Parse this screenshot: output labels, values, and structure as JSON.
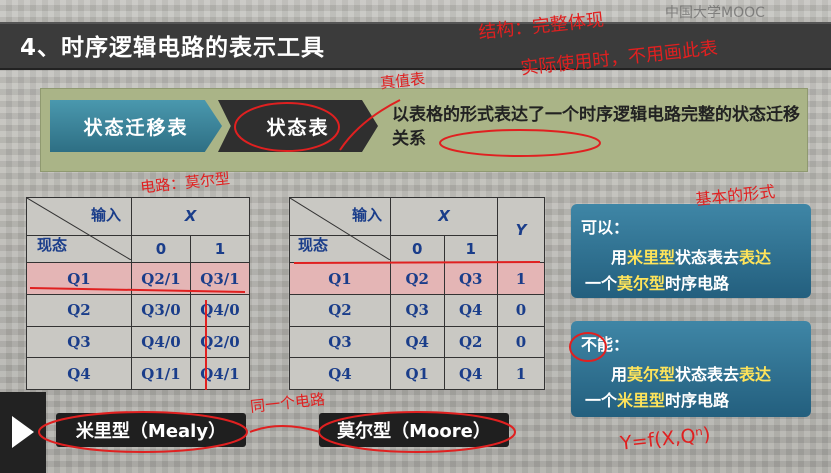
{
  "header": {
    "title": "4、时序逻辑电路的表示工具",
    "logo": "中国大学MOOC"
  },
  "tabs": {
    "tab1": "状态迁移表",
    "tab2": "状态表"
  },
  "description": "以表格的形式表达了一个时序逻辑电路完整的状态迁移关系",
  "table1": {
    "input_label": "输入",
    "present_label": "现态",
    "x_label": "X",
    "cols": [
      "0",
      "1"
    ],
    "rows": [
      {
        "q": "Q1",
        "c0": "Q2/1",
        "c1": "Q3/1"
      },
      {
        "q": "Q2",
        "c0": "Q3/0",
        "c1": "Q4/0"
      },
      {
        "q": "Q3",
        "c0": "Q4/0",
        "c1": "Q2/0"
      },
      {
        "q": "Q4",
        "c0": "Q1/1",
        "c1": "Q4/1"
      }
    ]
  },
  "table2": {
    "input_label": "输入",
    "present_label": "现态",
    "x_label": "X",
    "y_label": "Y",
    "cols": [
      "0",
      "1"
    ],
    "rows": [
      {
        "q": "Q1",
        "c0": "Q2",
        "c1": "Q3",
        "y": "1"
      },
      {
        "q": "Q2",
        "c0": "Q3",
        "c1": "Q4",
        "y": "0"
      },
      {
        "q": "Q3",
        "c0": "Q4",
        "c1": "Q2",
        "y": "0"
      },
      {
        "q": "Q4",
        "c0": "Q1",
        "c1": "Q4",
        "y": "1"
      }
    ]
  },
  "can_box": {
    "head": "可以：",
    "line1_a": "用",
    "line1_b": "米里型",
    "line1_c": "状态表去",
    "line1_d": "表达",
    "line2_a": "一个",
    "line2_b": "莫尔型",
    "line2_c": "时序电路"
  },
  "cannot_box": {
    "head": "不能：",
    "line1_a": "用",
    "line1_b": "莫尔型",
    "line1_c": "状态表去",
    "line1_d": "表达",
    "line2_a": "一个",
    "line2_b": "米里型",
    "line2_c": "时序电路"
  },
  "labels": {
    "mealy": "米里型（Mealy）",
    "moore": "莫尔型（Moore）"
  },
  "annotations": {
    "a1": "结构：完整体现",
    "a2": "实际使用时，不用画此表",
    "a3": "真值表",
    "a4": "电路：莫尔型",
    "a5": "基本的形式",
    "a6": "同一个电路",
    "a7": "Y=f(X,Qⁿ)"
  },
  "colors": {
    "accent": "#e02020",
    "tab_blue": "#2e6f84"
  }
}
